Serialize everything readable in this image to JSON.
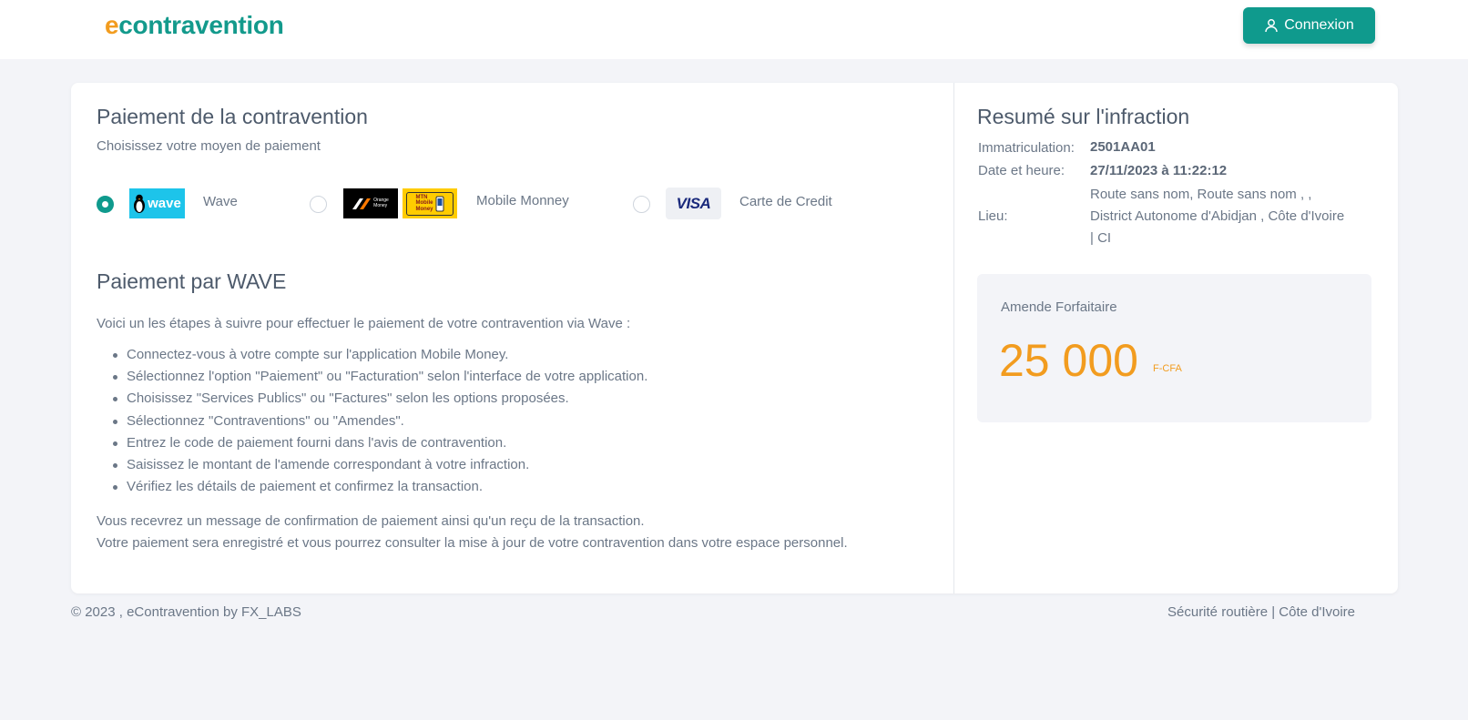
{
  "header": {
    "logo_e": "e",
    "logo_rest": "contravention",
    "login_label": "Connexion"
  },
  "payment": {
    "title": "Paiement de la contravention",
    "subtitle": "Choisissez votre moyen de paiement",
    "options": [
      {
        "label": "Wave",
        "selected": true
      },
      {
        "label": "Mobile Monney",
        "selected": false
      },
      {
        "label": "Carte de Credit",
        "selected": false
      }
    ],
    "logos": {
      "wave": "wave",
      "orange_money_line1": "Orange",
      "orange_money_line2": "Money",
      "mtn_line1": "MTN",
      "mtn_line2": "Mobile",
      "mtn_line3": "Money",
      "visa": "VISA"
    }
  },
  "wave_section": {
    "title": "Paiement par WAVE",
    "intro": "Voici un les étapes à suivre pour effectuer le paiement de votre contravention via Wave :",
    "steps": [
      "Connectez-vous à votre compte sur l'application Mobile Money.",
      "Sélectionnez l'option \"Paiement\" ou \"Facturation\" selon l'interface de votre application.",
      "Choisissez \"Services Publics\" ou \"Factures\" selon les options proposées.",
      "Sélectionnez \"Contraventions\" ou \"Amendes\".",
      "Entrez le code de paiement fourni dans l'avis de contravention.",
      "Saisissez le montant de l'amende correspondant à votre infraction.",
      "Vérifiez les détails de paiement et confirmez la transaction."
    ],
    "outro_1": "Vous recevrez un message de confirmation de paiement ainsi qu'un reçu de la transaction.",
    "outro_2": "Votre paiement sera enregistré et vous pourrez consulter la mise à jour de votre contravention dans votre espace personnel."
  },
  "summary": {
    "title": "Resumé sur l'infraction",
    "immat_label": "Immatriculation:",
    "immat_value": "2501AA01",
    "date_label": "Date et heure:",
    "date_value": "27/11/2023 à 11:22:12",
    "lieu_label": "Lieu:",
    "lieu_line1": "Route sans nom, Route sans nom , ,",
    "lieu_line2": "District Autonome d'Abidjan , Côte d'Ivoire",
    "lieu_line3": "| CI",
    "amende_label": "Amende Forfaitaire",
    "amende_value": "25 000",
    "amende_currency": "F-CFA"
  },
  "footer": {
    "left": "© 2023 , eContravention by FX_LABS",
    "right": "Sécurité routière | Côte d'Ivoire"
  },
  "colors": {
    "accent": "#0f9a8d",
    "orange": "#f29c1f",
    "background": "#f3f4f8"
  }
}
